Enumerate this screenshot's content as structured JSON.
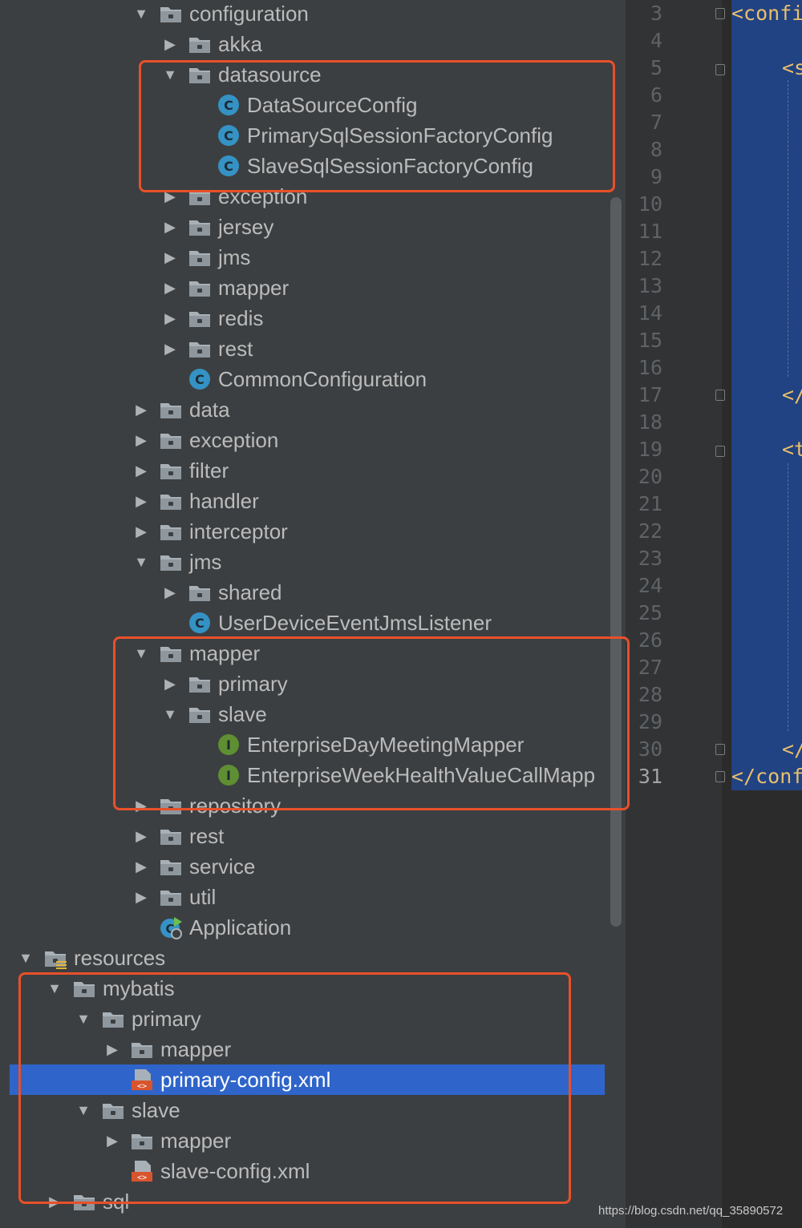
{
  "project_tree": {
    "rows": [
      {
        "label": "configuration",
        "kind": "folder",
        "arrow": "open"
      },
      {
        "label": "akka",
        "kind": "folder",
        "arrow": "closed"
      },
      {
        "label": "datasource",
        "kind": "folder",
        "arrow": "open"
      },
      {
        "label": "DataSourceConfig",
        "kind": "class",
        "arrow": "none"
      },
      {
        "label": "PrimarySqlSessionFactoryConfig",
        "kind": "class",
        "arrow": "none"
      },
      {
        "label": "SlaveSqlSessionFactoryConfig",
        "kind": "class",
        "arrow": "none"
      },
      {
        "label": "exception",
        "kind": "folder",
        "arrow": "closed"
      },
      {
        "label": "jersey",
        "kind": "folder",
        "arrow": "closed"
      },
      {
        "label": "jms",
        "kind": "folder",
        "arrow": "closed"
      },
      {
        "label": "mapper",
        "kind": "folder",
        "arrow": "closed"
      },
      {
        "label": "redis",
        "kind": "folder",
        "arrow": "closed"
      },
      {
        "label": "rest",
        "kind": "folder",
        "arrow": "closed"
      },
      {
        "label": "CommonConfiguration",
        "kind": "class",
        "arrow": "none"
      },
      {
        "label": "data",
        "kind": "folder",
        "arrow": "closed"
      },
      {
        "label": "exception",
        "kind": "folder",
        "arrow": "closed"
      },
      {
        "label": "filter",
        "kind": "folder",
        "arrow": "closed"
      },
      {
        "label": "handler",
        "kind": "folder",
        "arrow": "closed"
      },
      {
        "label": "interceptor",
        "kind": "folder",
        "arrow": "closed"
      },
      {
        "label": "jms",
        "kind": "folder",
        "arrow": "open"
      },
      {
        "label": "shared",
        "kind": "folder",
        "arrow": "closed"
      },
      {
        "label": "UserDeviceEventJmsListener",
        "kind": "class",
        "arrow": "none"
      },
      {
        "label": "mapper",
        "kind": "folder",
        "arrow": "open"
      },
      {
        "label": "primary",
        "kind": "folder",
        "arrow": "closed"
      },
      {
        "label": "slave",
        "kind": "folder",
        "arrow": "open"
      },
      {
        "label": "EnterpriseDayMeetingMapper",
        "kind": "interface",
        "arrow": "none"
      },
      {
        "label": "EnterpriseWeekHealthValueCallMapp",
        "kind": "interface",
        "arrow": "none"
      },
      {
        "label": "repository",
        "kind": "folder",
        "arrow": "closed"
      },
      {
        "label": "rest",
        "kind": "folder",
        "arrow": "closed"
      },
      {
        "label": "service",
        "kind": "folder",
        "arrow": "closed"
      },
      {
        "label": "util",
        "kind": "folder",
        "arrow": "closed"
      },
      {
        "label": "Application",
        "kind": "springboot-class",
        "arrow": "none"
      },
      {
        "label": "resources",
        "kind": "resources-folder",
        "arrow": "open"
      },
      {
        "label": "mybatis",
        "kind": "folder",
        "arrow": "open"
      },
      {
        "label": "primary",
        "kind": "folder",
        "arrow": "open"
      },
      {
        "label": "mapper",
        "kind": "folder",
        "arrow": "closed"
      },
      {
        "label": "primary-config.xml",
        "kind": "xml-file",
        "arrow": "none",
        "selected": true
      },
      {
        "label": "slave",
        "kind": "folder",
        "arrow": "open"
      },
      {
        "label": "mapper",
        "kind": "folder",
        "arrow": "closed"
      },
      {
        "label": "slave-config.xml",
        "kind": "xml-file",
        "arrow": "none"
      },
      {
        "label": "sql",
        "kind": "folder",
        "arrow": "closed"
      }
    ]
  },
  "editor": {
    "line_numbers": [
      "3",
      "4",
      "5",
      "6",
      "7",
      "8",
      "9",
      "10",
      "11",
      "12",
      "13",
      "14",
      "15",
      "16",
      "17",
      "18",
      "19",
      "20",
      "21",
      "22",
      "23",
      "24",
      "25",
      "26",
      "27",
      "28",
      "29",
      "30",
      "31"
    ],
    "current_line": "31",
    "code_fragments": [
      "<confi",
      "<s",
      "</",
      "<t",
      "</",
      "</conf"
    ]
  },
  "watermark": "https://blog.csdn.net/qq_35890572",
  "colors": {
    "tree_background": "#3c3f41",
    "selection": "#2f65ca",
    "highlight_border": "#e8502b",
    "class_icon": "#3592c4",
    "interface_icon": "#5e8f32",
    "editor_selection": "#214283",
    "xml_tag": "#e8bf6a"
  }
}
